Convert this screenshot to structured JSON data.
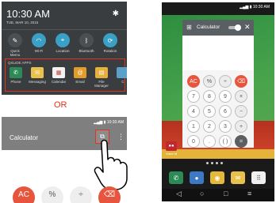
{
  "panel": {
    "time": "10:30 AM",
    "date": "TUE, MAR 10, 2015",
    "quick_settings": [
      {
        "label": "Quick\nMemo",
        "icon": "quick-memo-icon",
        "color": "#4a4f53",
        "glyph": "✎"
      },
      {
        "label": "Wi-Fi",
        "icon": "wifi-icon",
        "color": "#3aa0c6",
        "glyph": "◠"
      },
      {
        "label": "Location",
        "icon": "location-icon",
        "color": "#3aa0c6",
        "glyph": "⌖"
      },
      {
        "label": "Bluetooth",
        "icon": "bluetooth-icon",
        "color": "#4a4f53",
        "glyph": "ᛒ"
      },
      {
        "label": "Rotation",
        "icon": "rotation-icon",
        "color": "#3aa0c6",
        "glyph": "⟳"
      }
    ],
    "apps_title": "QSLIDE APPS",
    "apps": [
      {
        "label": "Phone",
        "icon": "phone-icon",
        "color": "#2b8a56",
        "glyph": "✆"
      },
      {
        "label": "Messaging",
        "icon": "messaging-icon",
        "color": "#e8c24a",
        "glyph": "✉"
      },
      {
        "label": "Calendar",
        "icon": "calendar-icon",
        "color": "#f2f2f2",
        "glyph": "▦"
      },
      {
        "label": "Email",
        "icon": "email-icon",
        "color": "#e39b2a",
        "glyph": "@"
      },
      {
        "label": "File\nManager",
        "icon": "file-manager-icon",
        "color": "#e6b03c",
        "glyph": "▤"
      },
      {
        "label": "C",
        "icon": "calculator-icon",
        "color": "#5aa0c8",
        "glyph": ""
      }
    ]
  },
  "or_label": "OR",
  "calc_bar": {
    "status_time": "10:30 AM",
    "title": "Calculator"
  },
  "bottom_keys": [
    {
      "label": "AC",
      "color": "#e8553e",
      "text_color": "#ffffff"
    },
    {
      "label": "%",
      "color": "#eeeeee",
      "text_color": "#555555"
    },
    {
      "label": "÷",
      "color": "#eeeeee",
      "text_color": "#555555"
    },
    {
      "label": "⌫",
      "color": "#e8553e",
      "text_color": "#ffffff"
    }
  ],
  "phone": {
    "status_time": "10:30 AM",
    "voice_label": "Voice M",
    "calc_window": {
      "title": "Calculator",
      "keys": [
        {
          "label": "AC",
          "style": "red"
        },
        {
          "label": "%",
          "style": "op"
        },
        {
          "label": "÷",
          "style": "op"
        },
        {
          "label": "⌫",
          "style": "red"
        },
        {
          "label": "7",
          "style": "num"
        },
        {
          "label": "8",
          "style": "num"
        },
        {
          "label": "9",
          "style": "num"
        },
        {
          "label": "×",
          "style": "op"
        },
        {
          "label": "4",
          "style": "num"
        },
        {
          "label": "5",
          "style": "num"
        },
        {
          "label": "6",
          "style": "num"
        },
        {
          "label": "−",
          "style": "op"
        },
        {
          "label": "1",
          "style": "num"
        },
        {
          "label": "2",
          "style": "num"
        },
        {
          "label": "3",
          "style": "num"
        },
        {
          "label": "+",
          "style": "op"
        },
        {
          "label": "0",
          "style": "num"
        },
        {
          "label": ".",
          "style": "num"
        },
        {
          "label": "( )",
          "style": "num"
        },
        {
          "label": "=",
          "style": "eq"
        }
      ]
    },
    "dock": [
      {
        "icon": "phone-icon",
        "color": "#2b8a56",
        "glyph": "✆"
      },
      {
        "icon": "contacts-icon",
        "color": "#3b79c4",
        "glyph": "●"
      },
      {
        "icon": "chrome-icon",
        "color": "#e4b93a",
        "glyph": "◉"
      },
      {
        "icon": "messaging-icon",
        "color": "#e8c24a",
        "glyph": "✉"
      },
      {
        "icon": "apps-icon",
        "color": "#f0f0f0",
        "glyph": "⠿"
      }
    ],
    "nav": [
      {
        "icon": "back-icon",
        "glyph": "◁"
      },
      {
        "icon": "home-icon",
        "glyph": "○"
      },
      {
        "icon": "recents-icon",
        "glyph": "□"
      },
      {
        "icon": "menu-icon",
        "glyph": "≡"
      }
    ]
  }
}
